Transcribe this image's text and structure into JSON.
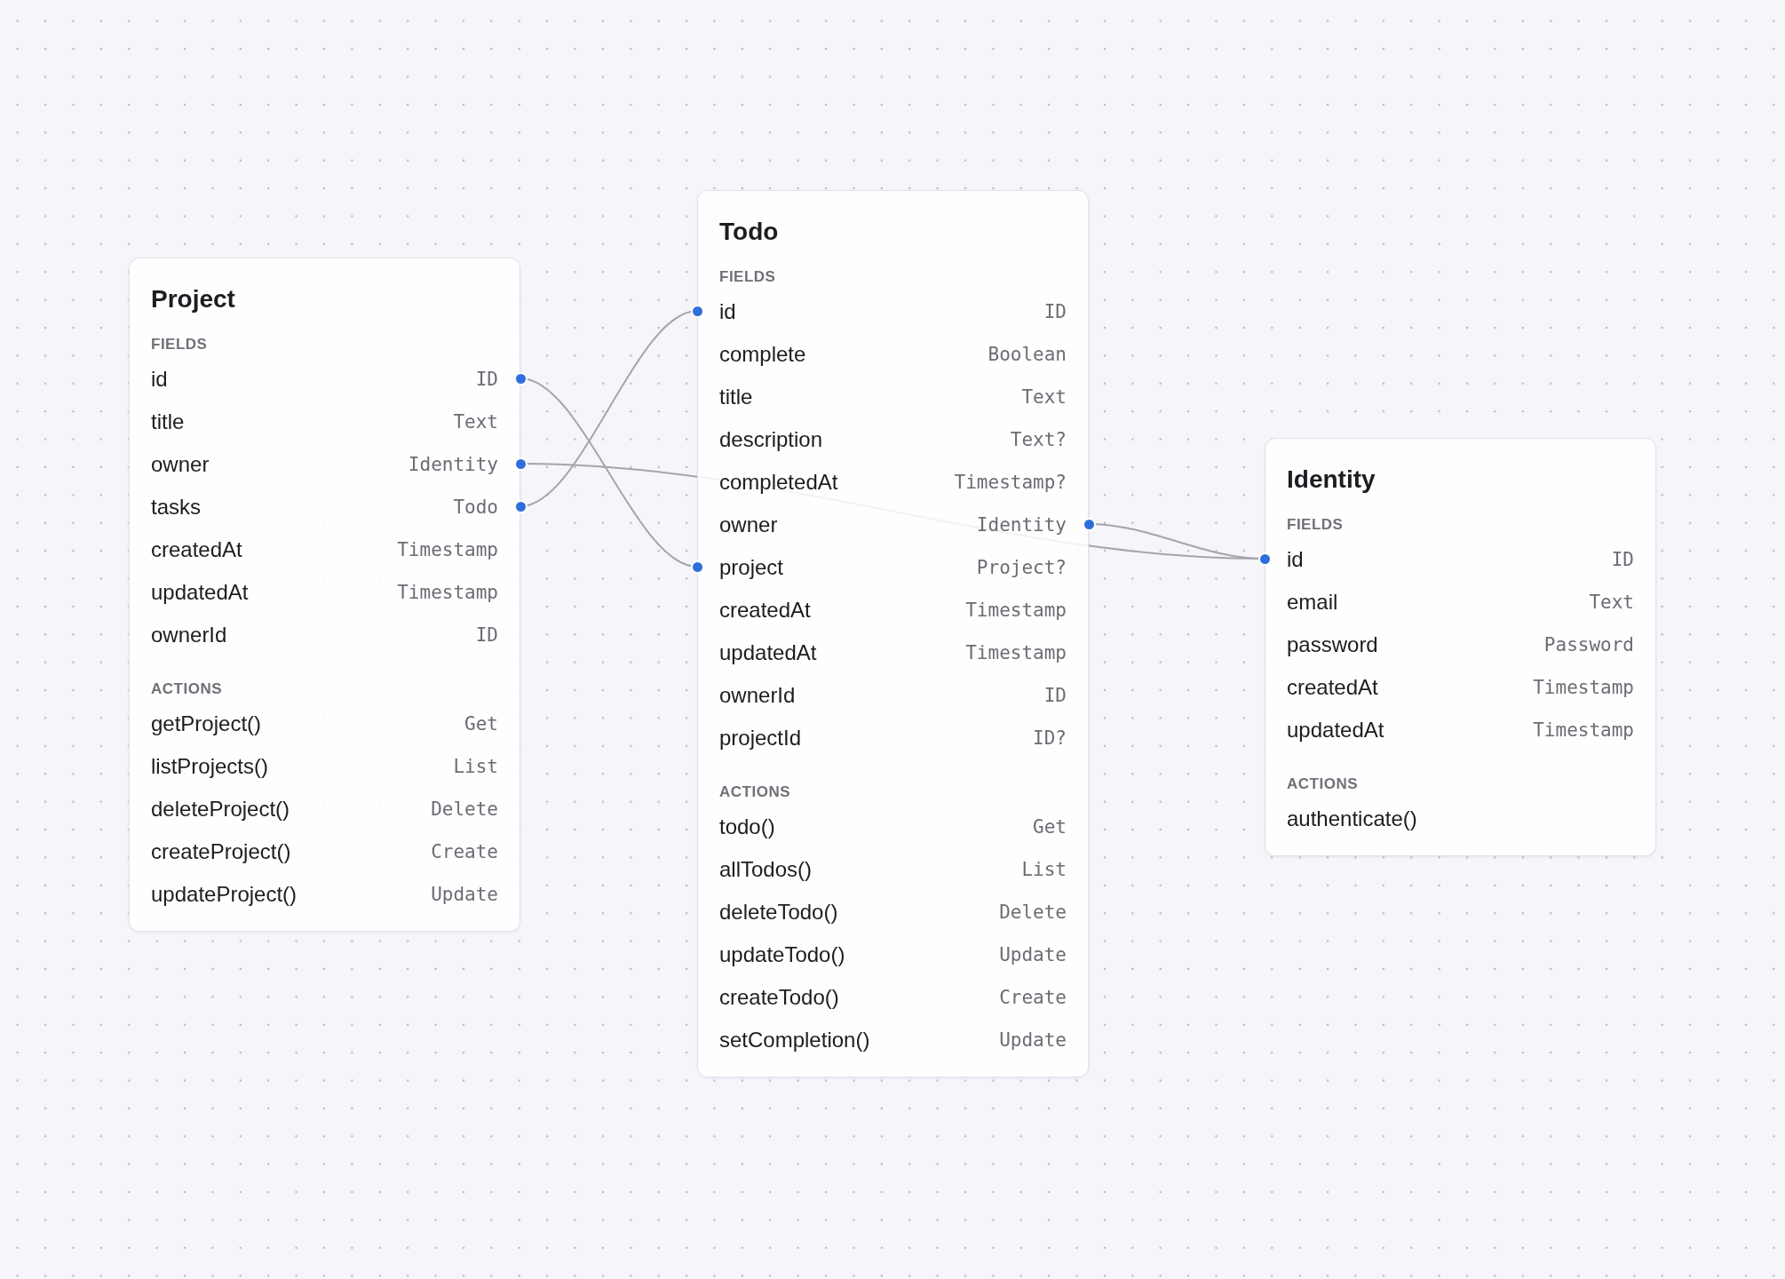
{
  "cards": [
    {
      "title": "Project",
      "sections": [
        {
          "label": "FIELDS",
          "rows": [
            {
              "name": "id",
              "type": "ID",
              "port_left": false,
              "port_right": true
            },
            {
              "name": "title",
              "type": "Text",
              "port_left": false,
              "port_right": false
            },
            {
              "name": "owner",
              "type": "Identity",
              "port_left": false,
              "port_right": true
            },
            {
              "name": "tasks",
              "type": "Todo",
              "port_left": false,
              "port_right": true
            },
            {
              "name": "createdAt",
              "type": "Timestamp",
              "port_left": false,
              "port_right": false
            },
            {
              "name": "updatedAt",
              "type": "Timestamp",
              "port_left": false,
              "port_right": false
            },
            {
              "name": "ownerId",
              "type": "ID",
              "port_left": false,
              "port_right": false
            }
          ]
        },
        {
          "label": "ACTIONS",
          "rows": [
            {
              "name": "getProject()",
              "type": "Get",
              "port_left": false,
              "port_right": false
            },
            {
              "name": "listProjects()",
              "type": "List",
              "port_left": false,
              "port_right": false
            },
            {
              "name": "deleteProject()",
              "type": "Delete",
              "port_left": false,
              "port_right": false
            },
            {
              "name": "createProject()",
              "type": "Create",
              "port_left": false,
              "port_right": false
            },
            {
              "name": "updateProject()",
              "type": "Update",
              "port_left": false,
              "port_right": false
            }
          ]
        }
      ]
    },
    {
      "title": "Todo",
      "sections": [
        {
          "label": "FIELDS",
          "rows": [
            {
              "name": "id",
              "type": "ID",
              "port_left": true,
              "port_right": false
            },
            {
              "name": "complete",
              "type": "Boolean",
              "port_left": false,
              "port_right": false
            },
            {
              "name": "title",
              "type": "Text",
              "port_left": false,
              "port_right": false
            },
            {
              "name": "description",
              "type": "Text?",
              "port_left": false,
              "port_right": false
            },
            {
              "name": "completedAt",
              "type": "Timestamp?",
              "port_left": false,
              "port_right": false
            },
            {
              "name": "owner",
              "type": "Identity",
              "port_left": false,
              "port_right": true
            },
            {
              "name": "project",
              "type": "Project?",
              "port_left": true,
              "port_right": false
            },
            {
              "name": "createdAt",
              "type": "Timestamp",
              "port_left": false,
              "port_right": false
            },
            {
              "name": "updatedAt",
              "type": "Timestamp",
              "port_left": false,
              "port_right": false
            },
            {
              "name": "ownerId",
              "type": "ID",
              "port_left": false,
              "port_right": false
            },
            {
              "name": "projectId",
              "type": "ID?",
              "port_left": false,
              "port_right": false
            }
          ]
        },
        {
          "label": "ACTIONS",
          "rows": [
            {
              "name": "todo()",
              "type": "Get",
              "port_left": false,
              "port_right": false
            },
            {
              "name": "allTodos()",
              "type": "List",
              "port_left": false,
              "port_right": false
            },
            {
              "name": "deleteTodo()",
              "type": "Delete",
              "port_left": false,
              "port_right": false
            },
            {
              "name": "updateTodo()",
              "type": "Update",
              "port_left": false,
              "port_right": false
            },
            {
              "name": "createTodo()",
              "type": "Create",
              "port_left": false,
              "port_right": false
            },
            {
              "name": "setCompletion()",
              "type": "Update",
              "port_left": false,
              "port_right": false
            }
          ]
        }
      ]
    },
    {
      "title": "Identity",
      "sections": [
        {
          "label": "FIELDS",
          "rows": [
            {
              "name": "id",
              "type": "ID",
              "port_left": true,
              "port_right": false
            },
            {
              "name": "email",
              "type": "Text",
              "port_left": false,
              "port_right": false
            },
            {
              "name": "password",
              "type": "Password",
              "port_left": false,
              "port_right": false
            },
            {
              "name": "createdAt",
              "type": "Timestamp",
              "port_left": false,
              "port_right": false
            },
            {
              "name": "updatedAt",
              "type": "Timestamp",
              "port_left": false,
              "port_right": false
            }
          ]
        },
        {
          "label": "ACTIONS",
          "rows": [
            {
              "name": "authenticate()",
              "port_left": false,
              "port_right": false
            }
          ]
        }
      ]
    }
  ]
}
